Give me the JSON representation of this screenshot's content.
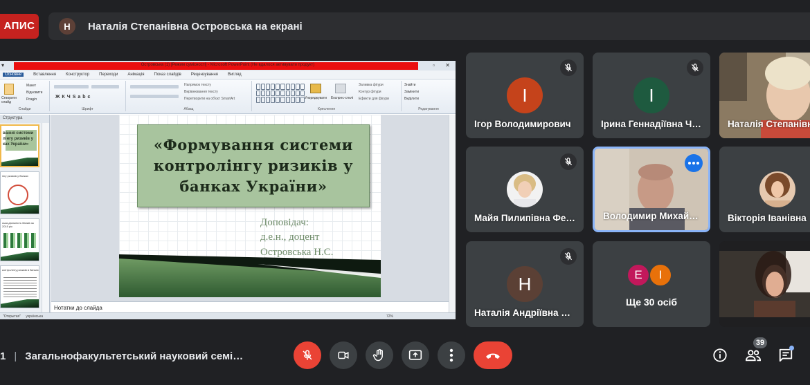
{
  "recording": {
    "label": "АПИС"
  },
  "presenting": {
    "avatar_letter": "Н",
    "text": "Наталія Степанівна Островська на екрані"
  },
  "ppt": {
    "title": "Островська (1) [Режим сумісності] - Microsoft PowerPoint (Не вдалося активувати продукт)",
    "menu": [
      "Основне",
      "Вставлення",
      "Конструктор",
      "Переходи",
      "Анімація",
      "Показ слайдів",
      "Рецензування",
      "Вигляд"
    ],
    "ribbon_groups": [
      "Слайди",
      "Шрифт",
      "Абзац",
      "Креслення",
      "Редагування"
    ],
    "ribbon_items": {
      "layout": "Макет",
      "reset": "Відновити",
      "section": "Розділ",
      "new_slide": "Створити слайд",
      "text_direction": "Напрямок тексту",
      "align_text": "Вирівнювання тексту",
      "smartart": "Перетворити на об'єкт SmartArt",
      "arrange": "Упорядкувати",
      "quick_styles": "Експрес-стилі",
      "fill": "Заливка фігури",
      "outline": "Контур фігури",
      "effects": "Ефекти для фігури",
      "find": "Знайти",
      "replace": "Замінити",
      "select": "Виділити"
    },
    "panel_tabs": {
      "structure": "Структура"
    },
    "thumbs": [
      {
        "text": "вання системи лінгу ризиків у ках України»"
      },
      {
        "text": "інгу ризиків у банках"
      },
      {
        "text": "ська діяльність банків за 2015 рік"
      },
      {
        "text": "контролінгу ризиків в банках"
      }
    ],
    "notes": "Нотатки до слайда",
    "status": {
      "theme": "\"Открытая\"",
      "lang": "українська",
      "zoom": "72%"
    }
  },
  "slide": {
    "title_lines": [
      "«Формування системи",
      "контролінгу ризиків у",
      "банках України»"
    ],
    "presenter_lines": [
      "Доповідач:",
      "д.е.н., доцент",
      "Островська Н.С."
    ]
  },
  "participants": [
    {
      "name": "Ігор Володимирович",
      "letter": "І",
      "color": "#c5431b",
      "muted": true
    },
    {
      "name": "Ірина Геннадіївна Ч…",
      "letter": "І",
      "color": "#1e5a3f",
      "muted": true
    },
    {
      "name": "Наталія Степанівна",
      "video": true,
      "muted": false
    },
    {
      "name": "Майя Пилипівна Фе…",
      "photo": true,
      "muted": true
    },
    {
      "name": "Володимир Михай…",
      "video": true,
      "active": true
    },
    {
      "name": "Вікторія Іванівна",
      "photo": true,
      "muted": false
    },
    {
      "name": "Наталія Андріївна Б…",
      "letter": "Н",
      "color": "#5b4035",
      "muted": true
    },
    {
      "more_label": "Ще 30 осіб",
      "mini": [
        {
          "letter": "Е",
          "color": "#c2185b"
        },
        {
          "letter": "І",
          "color": "#e8710a"
        }
      ]
    },
    {
      "name": "",
      "video": true
    }
  ],
  "meeting": {
    "time_tail": "1",
    "title": "Загальнофакультетський науковий семі…"
  },
  "controls": {
    "people_count": "39"
  },
  "colors": {
    "accent": "#8ab4f8",
    "danger": "#ea4335",
    "bg": "#202124",
    "tile": "#3c4043"
  }
}
